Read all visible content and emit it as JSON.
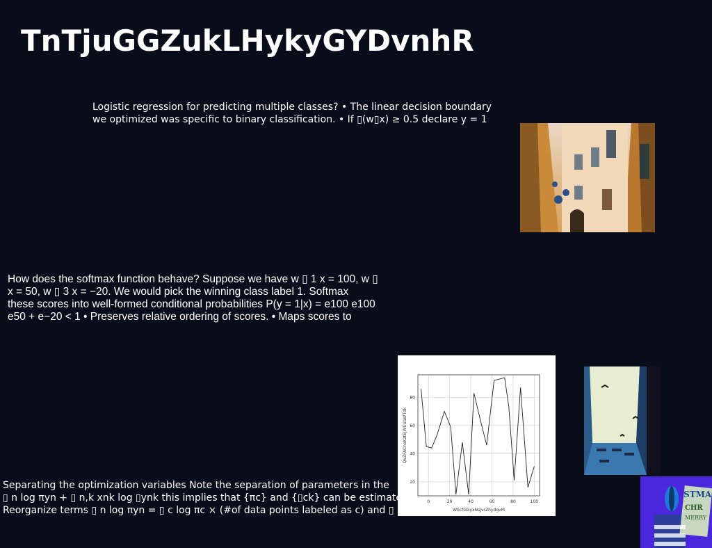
{
  "title": "TnTjuGGZukLHykyGYDvnhR",
  "paragraphs": {
    "p1": [
      "Logistic regression for predicting multiple classes? • The linear decision boundary",
      "we optimized was specific to binary classification. • If ▯(w▯x) ≥ 0.5 declare y = 1"
    ],
    "p2": [
      "How does the softmax function behave? Suppose we have w ▯ 1 x = 100, w ▯",
      "x = 50, w ▯ 3 x = −20. We would pick the winning class label 1. Softmax",
      "these scores into well-formed conditional probabilities P(y = 1|x) = e100 e100",
      "e50 + e−20 < 1 • Preserves relative ordering of scores. • Maps scores to"
    ],
    "p3": [
      "Separating the optimization variables Note the separation of parameters in the",
      "▯ n log πyn + ▯ n,k xnk log ▯ynk this implies that {πc} and {▯ck} can be estimated",
      "Reorganize terms ▯ n log πyn = ▯ c log πc × (#of data points labeled as c) and ▯"
    ]
  },
  "chart_data": {
    "type": "line",
    "title": "",
    "xlabel": "WbcfGGyxNsJvrZhydgvM",
    "ylabel": "QvZFACnoKztEJWEUaWTdk",
    "xlim": [
      -10,
      105
    ],
    "ylim": [
      10,
      96
    ],
    "xticks": [
      0,
      20,
      40,
      60,
      80,
      100
    ],
    "yticks": [
      20,
      40,
      60,
      80
    ],
    "grid": true,
    "series": [
      {
        "color": "#222222",
        "x": [
          -7,
          -2,
          3,
          8,
          15,
          21,
          26,
          32,
          38,
          43,
          49,
          55,
          62,
          72,
          76,
          81,
          87,
          94,
          100
        ],
        "y": [
          86,
          45,
          44,
          53,
          70,
          59,
          11,
          48,
          11,
          83,
          64,
          46,
          92,
          94,
          73,
          21,
          87,
          16,
          31
        ]
      }
    ]
  },
  "images": {
    "building": "photo of a building with balconies",
    "alley": "photo of narrow blue alley with birds",
    "poster": "colorful poster graphic"
  }
}
